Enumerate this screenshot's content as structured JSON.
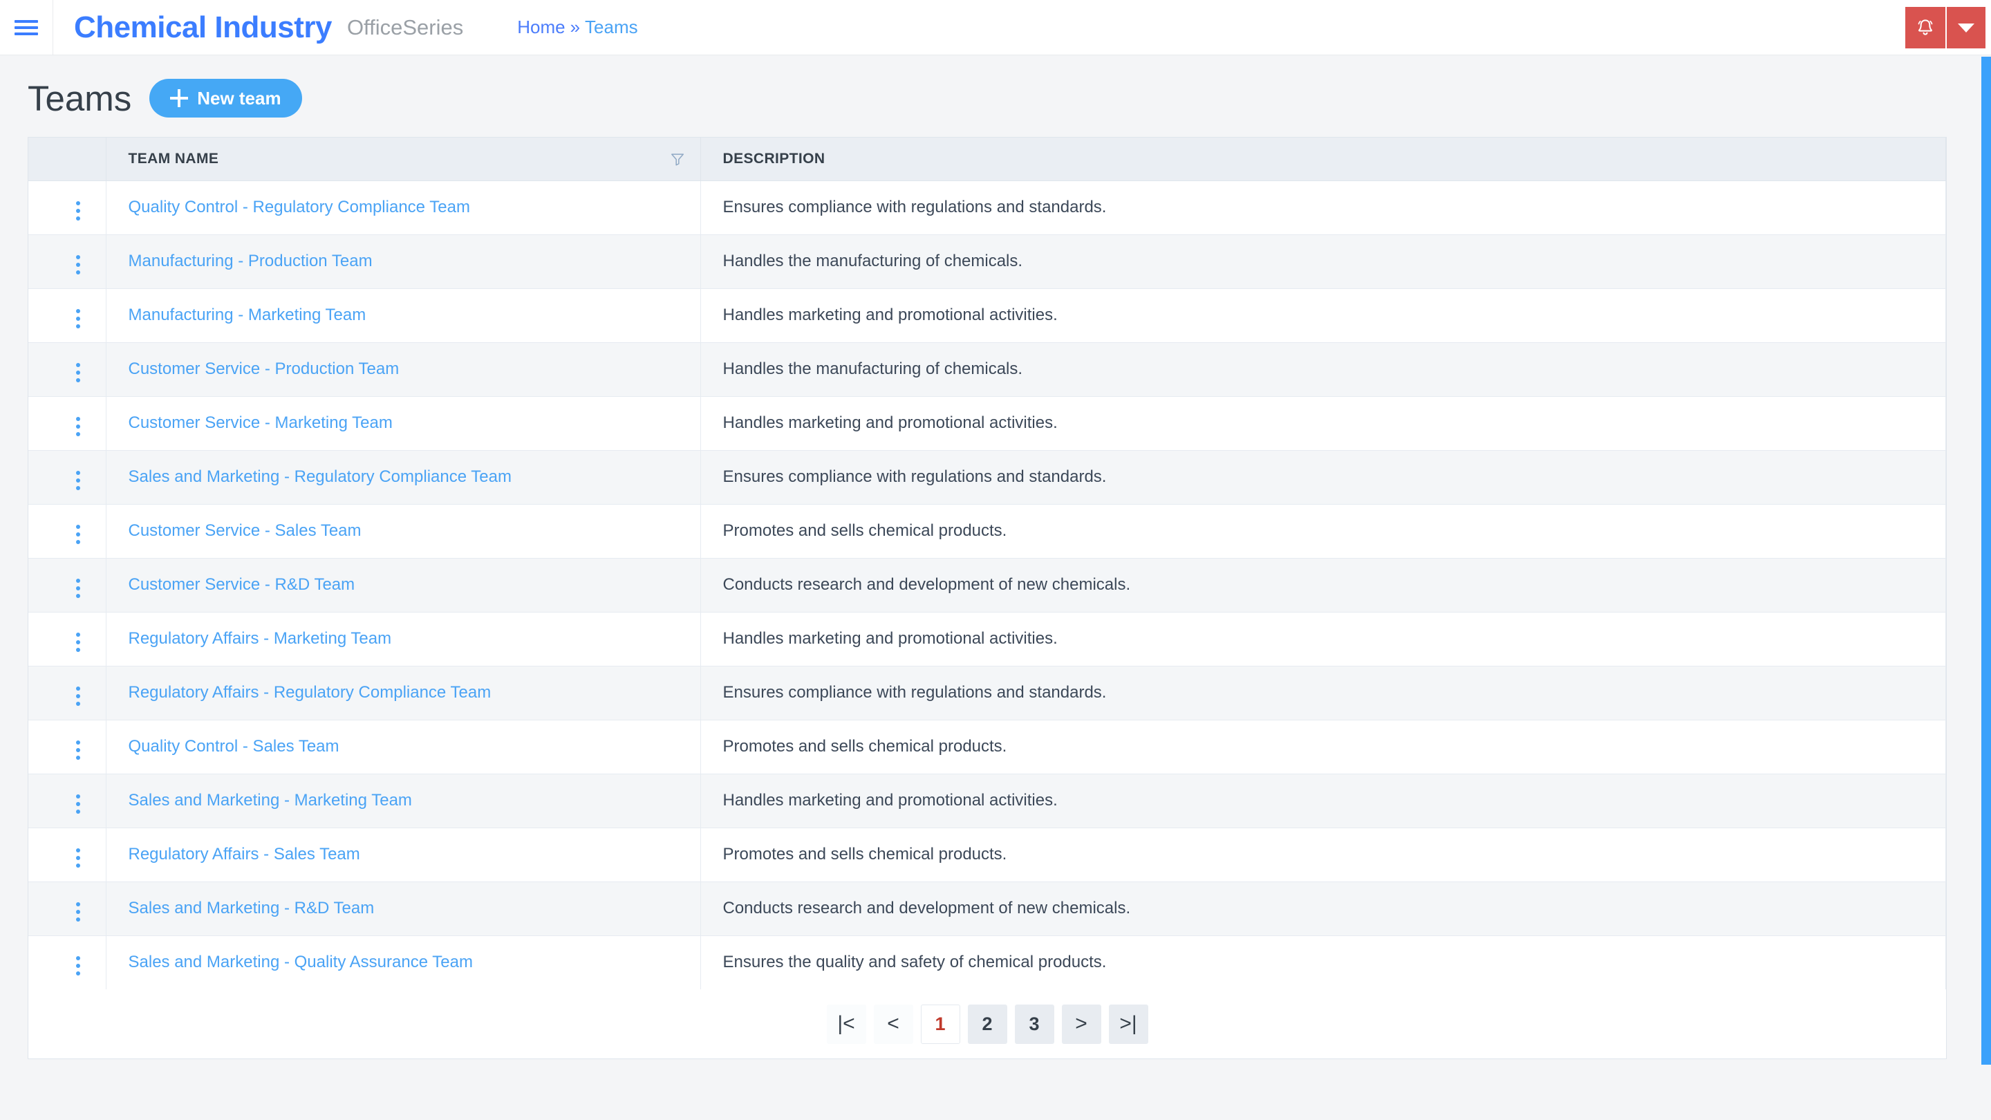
{
  "navbar": {
    "menu_icon": "hamburger-icon",
    "brand": "Chemical Industry",
    "brand_sub": "OfficeSeries",
    "breadcrumb": {
      "home": "Home",
      "separator": "»",
      "current": "Teams"
    },
    "bell_icon": "notification-bell-icon",
    "caret_icon": "chevron-down-icon",
    "accent_red": "#d9534f",
    "brand_blue": "#3b7dff"
  },
  "page": {
    "title": "Teams",
    "new_button": "New team",
    "new_button_icon": "plus-icon",
    "new_button_color": "#45a8f5"
  },
  "table": {
    "columns": {
      "menu": "",
      "name": "TEAM NAME",
      "description": "DESCRIPTION"
    },
    "filter_icon": "filter-funnel-icon",
    "row_menu_icon": "kebab-menu-icon",
    "rows": [
      {
        "name": "Quality Control - Regulatory Compliance Team",
        "description": "Ensures compliance with regulations and standards."
      },
      {
        "name": "Manufacturing - Production Team",
        "description": "Handles the manufacturing of chemicals."
      },
      {
        "name": "Manufacturing - Marketing Team",
        "description": "Handles marketing and promotional activities."
      },
      {
        "name": "Customer Service - Production Team",
        "description": "Handles the manufacturing of chemicals."
      },
      {
        "name": "Customer Service - Marketing Team",
        "description": "Handles marketing and promotional activities."
      },
      {
        "name": "Sales and Marketing - Regulatory Compliance Team",
        "description": "Ensures compliance with regulations and standards."
      },
      {
        "name": "Customer Service - Sales Team",
        "description": "Promotes and sells chemical products."
      },
      {
        "name": "Customer Service - R&D Team",
        "description": "Conducts research and development of new chemicals."
      },
      {
        "name": "Regulatory Affairs - Marketing Team",
        "description": "Handles marketing and promotional activities."
      },
      {
        "name": "Regulatory Affairs - Regulatory Compliance Team",
        "description": "Ensures compliance with regulations and standards."
      },
      {
        "name": "Quality Control - Sales Team",
        "description": "Promotes and sells chemical products."
      },
      {
        "name": "Sales and Marketing - Marketing Team",
        "description": "Handles marketing and promotional activities."
      },
      {
        "name": "Regulatory Affairs - Sales Team",
        "description": "Promotes and sells chemical products."
      },
      {
        "name": "Sales and Marketing - R&D Team",
        "description": "Conducts research and development of new chemicals."
      },
      {
        "name": "Sales and Marketing - Quality Assurance Team",
        "description": "Ensures the quality and safety of chemical products."
      }
    ]
  },
  "pagination": {
    "first_label": "|<",
    "prev_label": "<",
    "next_label": ">",
    "last_label": ">|",
    "pages": [
      "1",
      "2",
      "3"
    ],
    "current_page": "1",
    "current_color": "#c0392b"
  }
}
